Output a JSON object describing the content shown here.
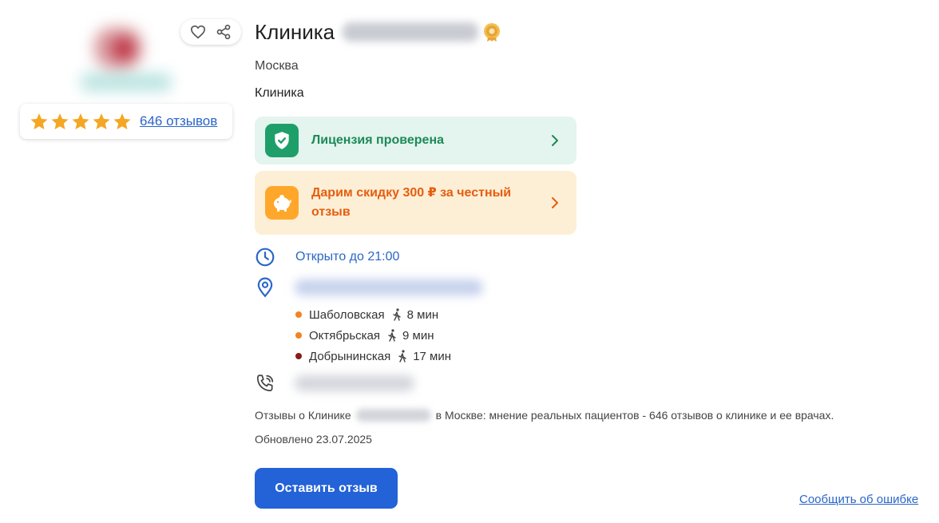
{
  "clinic": {
    "title_prefix": "Клиника",
    "city": "Москва",
    "type": "Клиника"
  },
  "rating": {
    "stars": 5,
    "reviews_link": "646 отзывов",
    "star_color": "#f5a623"
  },
  "actions": {
    "favorite_icon": "heart-icon",
    "share_icon": "share-icon"
  },
  "banners": {
    "license": {
      "text": "Лицензия проверена",
      "icon": "shield-check-icon"
    },
    "discount": {
      "text": "Дарим скидку 300 ₽ за честный отзыв",
      "icon": "piggy-bank-icon"
    }
  },
  "hours": {
    "text": "Открыто до 21:00",
    "icon": "clock-icon"
  },
  "address": {
    "icon": "location-pin-icon"
  },
  "metro": [
    {
      "station": "Шаболовская",
      "walk": "8 мин",
      "color": "#f58220"
    },
    {
      "station": "Октябрьская",
      "walk": "9 мин",
      "color": "#f58220"
    },
    {
      "station": "Добрынинская",
      "walk": "17 мин",
      "color": "#8b1a1a"
    }
  ],
  "phone": {
    "icon": "phone-icon"
  },
  "description": {
    "part1": "Отзывы о Клинике",
    "part2": "в Москве: мнение реальных пациентов - 646 отзывов о клинике и ее врачах."
  },
  "updated": "Обновлено 23.07.2025",
  "cta_label": "Оставить отзыв",
  "report_link": "Сообщить об ошибке"
}
